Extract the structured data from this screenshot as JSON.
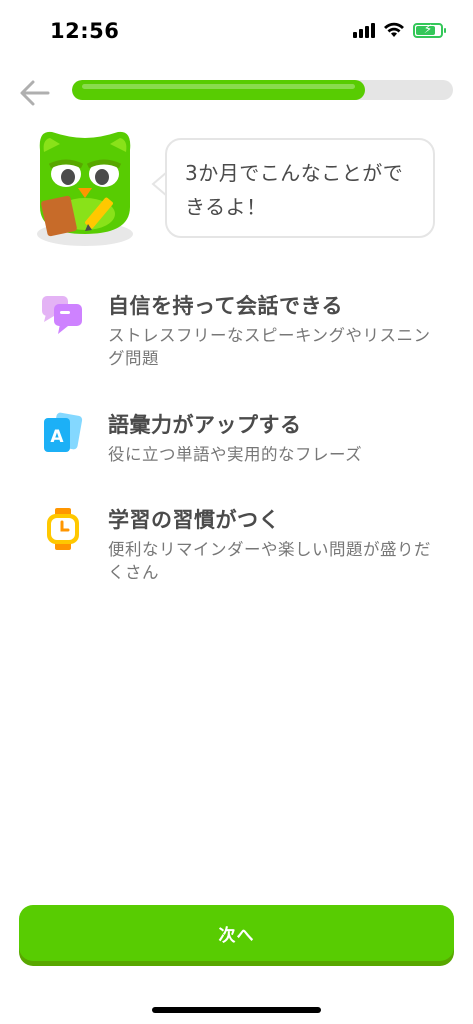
{
  "status_bar": {
    "time": "12:56",
    "battery_level": 0.8,
    "icons": [
      "signal-icon",
      "wifi-icon",
      "battery-charging-icon"
    ]
  },
  "header": {
    "back_icon": "arrow-left-icon",
    "progress": 0.77,
    "progress_color": "#58cc02",
    "track_color": "#e5e5e5"
  },
  "mascot": {
    "icon": "owl-mascot-icon",
    "speech": "3か月でこんなことができるよ！"
  },
  "benefits": [
    {
      "icon": "chat-bubbles-icon",
      "title": "自信を持って会話できる",
      "description": "ストレスフリーなスピーキングやリスニング問題"
    },
    {
      "icon": "flashcards-icon",
      "title": "語彙力がアップする",
      "description": "役に立つ単語や実用的なフレーズ"
    },
    {
      "icon": "watch-icon",
      "title": "学習の習慣がつく",
      "description": "便利なリマインダーや楽しい問題が盛りだくさん"
    }
  ],
  "footer": {
    "next_label": "次へ",
    "button_color": "#58cc02"
  }
}
